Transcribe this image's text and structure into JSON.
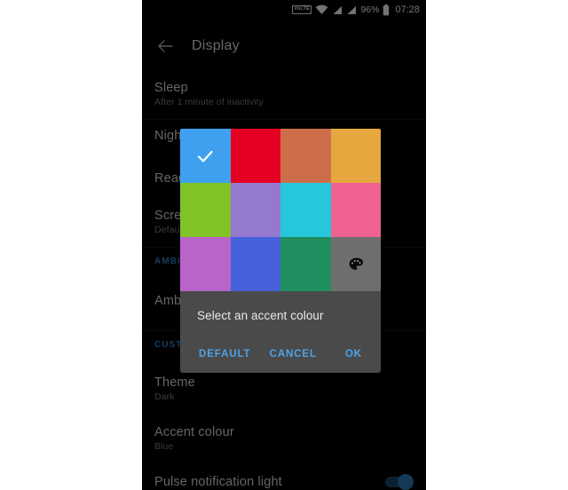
{
  "statusbar": {
    "volte_label": "VoLTE",
    "wifi_icon": "wifi-icon",
    "signal_icon_1": "signal-bars-icon",
    "signal_icon_2": "signal-bars-icon",
    "battery_percent": "96%",
    "battery_icon": "battery-full-icon",
    "time": "07:28"
  },
  "appbar": {
    "back_icon": "back-arrow-icon",
    "title": "Display"
  },
  "settings": {
    "rows": [
      {
        "title": "Sleep",
        "sub": "After 1 minute of inactivity"
      },
      {
        "title": "Night",
        "sub": ""
      },
      {
        "title": "Read",
        "sub": ""
      },
      {
        "title": "Scree",
        "sub": "Defaul"
      },
      {
        "title": "Amb",
        "sub": ""
      },
      {
        "title": "Theme",
        "sub": "Dark"
      },
      {
        "title": "Accent colour",
        "sub": "Blue"
      },
      {
        "title": "Pulse notification light",
        "sub": ""
      }
    ],
    "sections": [
      {
        "label": "AMBIE"
      },
      {
        "label": "CUSTO"
      }
    ],
    "pulse_toggle_state": "on"
  },
  "dialog": {
    "title": "Select an accent colour",
    "buttons": {
      "default_label": "DEFAULT",
      "cancel_label": "CANCEL",
      "ok_label": "OK"
    },
    "selected_index": 0,
    "check_icon": "check-icon",
    "custom_icon": "palette-icon",
    "swatches": [
      {
        "name": "blue",
        "color": "#3fa0ef"
      },
      {
        "name": "red",
        "color": "#e60023"
      },
      {
        "name": "terracotta",
        "color": "#cd6e4b"
      },
      {
        "name": "amber",
        "color": "#e6a83e"
      },
      {
        "name": "green",
        "color": "#7fc327"
      },
      {
        "name": "purple",
        "color": "#9579ce"
      },
      {
        "name": "cyan",
        "color": "#26c6dd"
      },
      {
        "name": "pink",
        "color": "#f06292"
      },
      {
        "name": "orchid",
        "color": "#b865c9"
      },
      {
        "name": "indigo",
        "color": "#4761da"
      },
      {
        "name": "sea-green",
        "color": "#1f8f5f"
      },
      {
        "name": "custom",
        "color": "#6e6e6e"
      }
    ]
  },
  "colors": {
    "accent_blue": "#4da3ea",
    "dialog_bg": "#4a4a4a",
    "screen_bg": "#000000",
    "letterbox": "#ffffff"
  }
}
